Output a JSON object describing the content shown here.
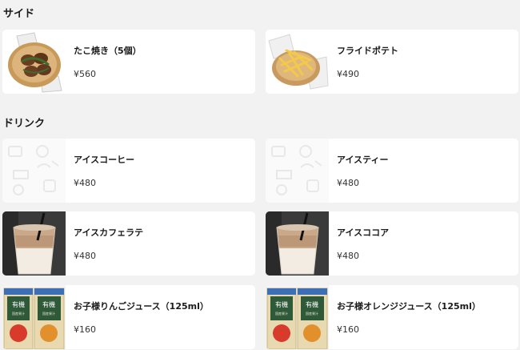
{
  "sections": [
    {
      "title": "サイド",
      "items": [
        {
          "name": "たこ焼き（5個）",
          "price": "¥560",
          "image": "takoyaki-photo"
        },
        {
          "name": "フライドポテト",
          "price": "¥490",
          "image": "fries-photo"
        }
      ]
    },
    {
      "title": "ドリンク",
      "items": [
        {
          "name": "アイスコーヒー",
          "price": "¥480",
          "image": "placeholder-pattern"
        },
        {
          "name": "アイスティー",
          "price": "¥480",
          "image": "placeholder-pattern"
        },
        {
          "name": "アイスカフェラテ",
          "price": "¥480",
          "image": "iced-latte-photo"
        },
        {
          "name": "アイスココア",
          "price": "¥480",
          "image": "iced-cocoa-photo"
        },
        {
          "name": "お子様りんごジュース（125ml）",
          "price": "¥160",
          "image": "apple-juice-box-photo"
        },
        {
          "name": "お子様オレンジジュース（125ml）",
          "price": "¥160",
          "image": "orange-juice-box-photo"
        }
      ]
    }
  ],
  "juice_box_text": {
    "top": "有機",
    "sub": "国産果汁"
  },
  "colors": {
    "background": "#f2f2f2",
    "card": "#ffffff"
  }
}
